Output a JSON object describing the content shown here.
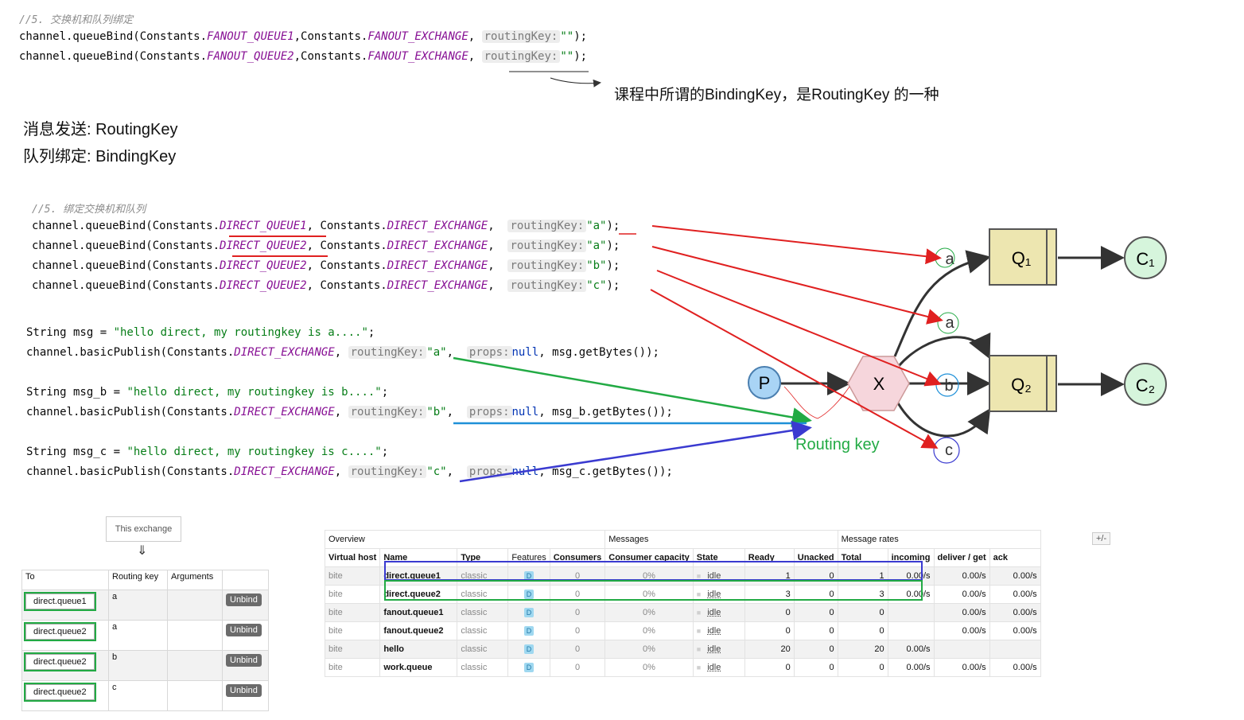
{
  "top_code": {
    "comment": "//5. 交换机和队列绑定",
    "lines": [
      {
        "pre": "channel.queueBind(Constants.",
        "q": "FANOUT_QUEUE1",
        "mid": ",Constants.",
        "ex": "FANOUT_EXCHANGE",
        ", ": ",",
        "hint": "routingKey:",
        "val": "\"\"",
        "end": ");"
      },
      {
        "pre": "channel.queueBind(Constants.",
        "q": "FANOUT_QUEUE2",
        "mid": ",Constants.",
        "ex": "FANOUT_EXCHANGE",
        ", ": ",",
        "hint": "routingKey:",
        "val": "\"\"",
        "end": ");"
      }
    ],
    "note": "课程中所谓的BindingKey，是RoutingKey 的一种"
  },
  "defs": {
    "line1": "消息发送: RoutingKey",
    "line2": "队列绑定: BindingKey"
  },
  "bind_code": {
    "comment": "//5. 绑定交换机和队列",
    "lines": [
      {
        "q": "DIRECT_QUEUE1",
        "val": "\"a\""
      },
      {
        "q": "DIRECT_QUEUE2",
        "val": "\"a\""
      },
      {
        "q": "DIRECT_QUEUE2",
        "val": "\"b\""
      },
      {
        "q": "DIRECT_QUEUE2",
        "val": "\"c\""
      }
    ],
    "pre": "channel.queueBind(Constants.",
    "mid": ", Constants.",
    "ex": "DIRECT_EXCHANGE",
    "sep": ",",
    "hint": "routingKey:",
    "end": ");"
  },
  "publish_code": [
    {
      "decl_pre": "String msg = ",
      "decl_str": "\"hello direct, my routingkey is a....\"",
      "decl_end": ";",
      "var": "msg",
      "key": "\"a\""
    },
    {
      "decl_pre": "String msg_b = ",
      "decl_str": "\"hello direct, my routingkey is b....\"",
      "decl_end": ";",
      "var": "msg_b",
      "key": "\"b\""
    },
    {
      "decl_pre": "String msg_c = ",
      "decl_str": "\"hello direct, my routingkey is c....\"",
      "decl_end": ";",
      "var": "msg_c",
      "key": "\"c\""
    }
  ],
  "publish_parts": {
    "pre": "channel.basicPublish(Constants.",
    "ex": "DIRECT_EXCHANGE",
    "sep": ",",
    "hint_key": "routingKey:",
    "hint_props": "props:",
    "null": "null",
    "tail": ".getBytes());"
  },
  "diagram": {
    "producer": "P",
    "exchange": "X",
    "queues": [
      "Q₁",
      "Q₂"
    ],
    "consumers": [
      "C₁",
      "C₂"
    ],
    "keys": [
      "a",
      "a",
      "b",
      "c"
    ],
    "routing_key_label": "Routing key",
    "colors": {
      "queue": "#ede6b0",
      "consumer": "#d6f5dc",
      "producer": "#a9d4f5",
      "exchange": "#f6d6dc",
      "red": "#e02020",
      "green": "#22aa44",
      "blue": "#3a3ad0",
      "cyan": "#1e90d8"
    }
  },
  "bindings_panel": {
    "source_label": "This exchange",
    "arrow": "⇓",
    "headers": [
      "To",
      "Routing key",
      "Arguments"
    ],
    "rows": [
      {
        "to": "direct.queue1",
        "key": "a",
        "action": "Unbind"
      },
      {
        "to": "direct.queue2",
        "key": "a",
        "action": "Unbind"
      },
      {
        "to": "direct.queue2",
        "key": "b",
        "action": "Unbind"
      },
      {
        "to": "direct.queue2",
        "key": "c",
        "action": "Unbind"
      }
    ]
  },
  "queues_table": {
    "groups": [
      "Overview",
      "Messages",
      "Message rates"
    ],
    "toggle": "+/-",
    "headers": [
      "Virtual host",
      "Name",
      "Type",
      "Features",
      "Consumers",
      "Consumer capacity",
      "State",
      "Ready",
      "Unacked",
      "Total",
      "incoming",
      "deliver / get",
      "ack"
    ],
    "rows": [
      {
        "vhost": "bite",
        "name": "direct.queue1",
        "type": "classic",
        "feat": "D",
        "consumers": "0",
        "capacity": "0%",
        "state": "idle",
        "ready": "1",
        "unacked": "0",
        "total": "1",
        "incoming": "0.00/s",
        "deliver": "0.00/s",
        "ack": "0.00/s"
      },
      {
        "vhost": "bite",
        "name": "direct.queue2",
        "type": "classic",
        "feat": "D",
        "consumers": "0",
        "capacity": "0%",
        "state": "idle",
        "ready": "3",
        "unacked": "0",
        "total": "3",
        "incoming": "0.00/s",
        "deliver": "0.00/s",
        "ack": "0.00/s"
      },
      {
        "vhost": "bite",
        "name": "fanout.queue1",
        "type": "classic",
        "feat": "D",
        "consumers": "0",
        "capacity": "0%",
        "state": "idle",
        "ready": "0",
        "unacked": "0",
        "total": "0",
        "incoming": "",
        "deliver": "0.00/s",
        "ack": "0.00/s"
      },
      {
        "vhost": "bite",
        "name": "fanout.queue2",
        "type": "classic",
        "feat": "D",
        "consumers": "0",
        "capacity": "0%",
        "state": "idle",
        "ready": "0",
        "unacked": "0",
        "total": "0",
        "incoming": "",
        "deliver": "0.00/s",
        "ack": "0.00/s"
      },
      {
        "vhost": "bite",
        "name": "hello",
        "type": "classic",
        "feat": "D",
        "consumers": "0",
        "capacity": "0%",
        "state": "idle",
        "ready": "20",
        "unacked": "0",
        "total": "20",
        "incoming": "0.00/s",
        "deliver": "",
        "ack": ""
      },
      {
        "vhost": "bite",
        "name": "work.queue",
        "type": "classic",
        "feat": "D",
        "consumers": "0",
        "capacity": "0%",
        "state": "idle",
        "ready": "0",
        "unacked": "0",
        "total": "0",
        "incoming": "0.00/s",
        "deliver": "0.00/s",
        "ack": "0.00/s"
      }
    ]
  }
}
